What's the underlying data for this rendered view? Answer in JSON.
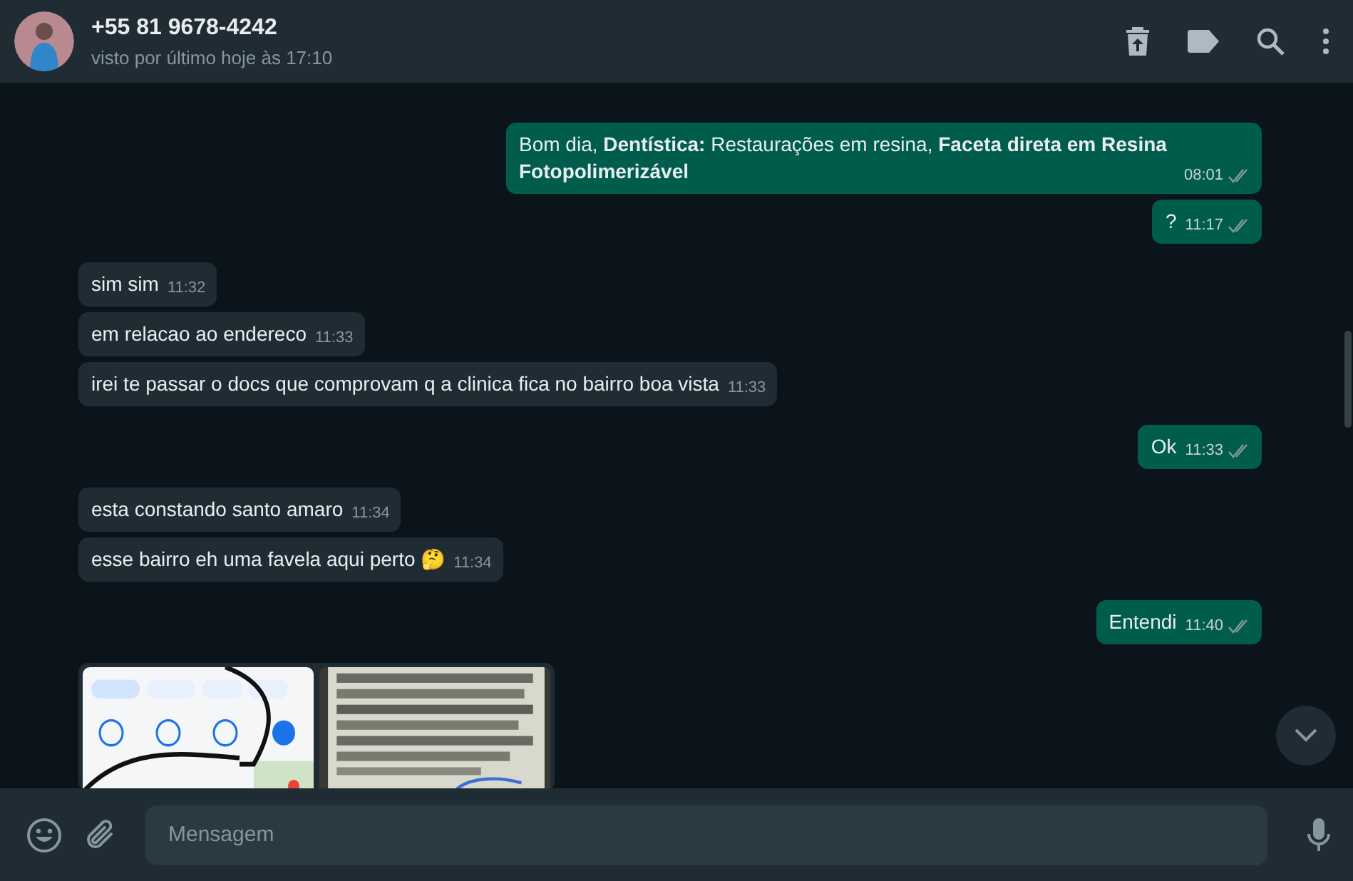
{
  "header": {
    "contact": "+55 81 9678-4242",
    "status": "visto por último hoje às 17:10"
  },
  "messages": [
    {
      "kind": "out",
      "text": "Bom dia, **Dentística:** Restaurações em resina, **Faceta direta em Resina Fotopolimerizável**",
      "time": "08:01"
    },
    {
      "kind": "out",
      "text": "?",
      "time": "11:17"
    },
    {
      "kind": "in",
      "text": "sim sim",
      "time": "11:32"
    },
    {
      "kind": "in",
      "text": "em relacao ao endereco",
      "time": "11:33"
    },
    {
      "kind": "in",
      "text": "irei te passar o docs que comprovam q a clinica fica no bairro boa vista",
      "time": "11:33"
    },
    {
      "kind": "out",
      "text": "Ok",
      "time": "11:33"
    },
    {
      "kind": "in",
      "text": "esta constando santo amaro",
      "time": "11:34"
    },
    {
      "kind": "in",
      "text": "esse bairro eh uma favela aqui perto 🤔",
      "time": "11:34"
    },
    {
      "kind": "out",
      "text": "Entendi",
      "time": "11:40"
    },
    {
      "kind": "media"
    }
  ],
  "composer": {
    "placeholder": "Mensagem"
  }
}
